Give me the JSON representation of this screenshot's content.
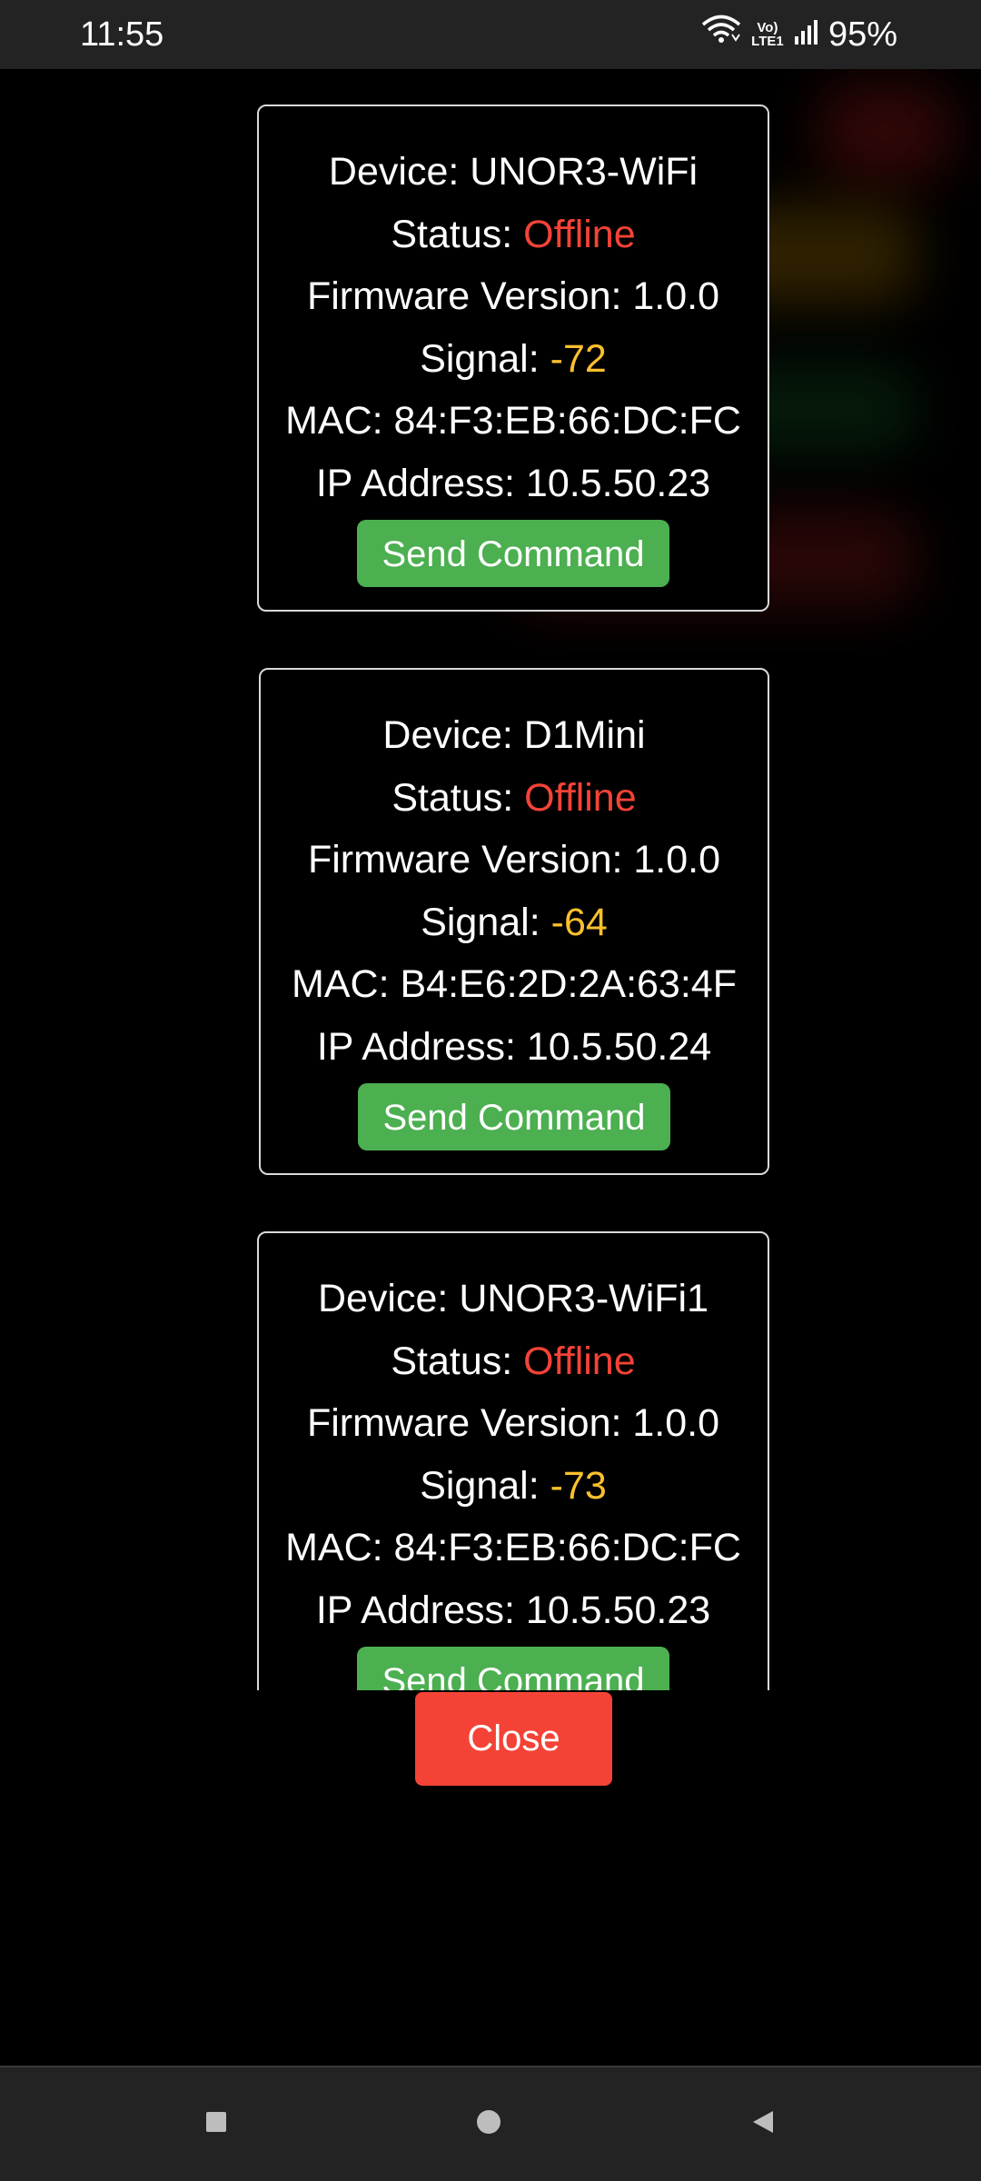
{
  "status_bar": {
    "time": "11:55",
    "network_label_top": "Vo)",
    "network_label_bottom": "LTE1",
    "battery": "95%"
  },
  "devices": [
    {
      "device_label": "Device: ",
      "device_name": "UNOR3-WiFi",
      "status_label": "Status: ",
      "status_value": "Offline",
      "firmware_label": "Firmware Version: ",
      "firmware_value": "1.0.0",
      "signal_label": "Signal: ",
      "signal_value": "-72",
      "mac_label": "MAC: ",
      "mac_value": "84:F3:EB:66:DC:FC",
      "ip_label": "IP Address: ",
      "ip_value": "10.5.50.23",
      "button_label": "Send Command"
    },
    {
      "device_label": "Device: ",
      "device_name": "D1Mini",
      "status_label": "Status: ",
      "status_value": "Offline",
      "firmware_label": "Firmware Version: ",
      "firmware_value": "1.0.0",
      "signal_label": "Signal: ",
      "signal_value": "-64",
      "mac_label": "MAC: ",
      "mac_value": "B4:E6:2D:2A:63:4F",
      "ip_label": "IP Address: ",
      "ip_value": "10.5.50.24",
      "button_label": "Send Command"
    },
    {
      "device_label": "Device: ",
      "device_name": "UNOR3-WiFi1",
      "status_label": "Status: ",
      "status_value": "Offline",
      "firmware_label": "Firmware Version: ",
      "firmware_value": "1.0.0",
      "signal_label": "Signal: ",
      "signal_value": "-73",
      "mac_label": "MAC: ",
      "mac_value": "84:F3:EB:66:DC:FC",
      "ip_label": "IP Address: ",
      "ip_value": "10.5.50.23",
      "button_label": "Send Command"
    }
  ],
  "close_button": {
    "label": "Close"
  },
  "colors": {
    "offline": "#f44336",
    "signal": "#fbc02d",
    "send_button": "#4caf50",
    "close_button": "#f44336"
  },
  "nav_bar": {
    "recents_icon": "square-icon",
    "home_icon": "circle-icon",
    "back_icon": "triangle-back-icon"
  }
}
